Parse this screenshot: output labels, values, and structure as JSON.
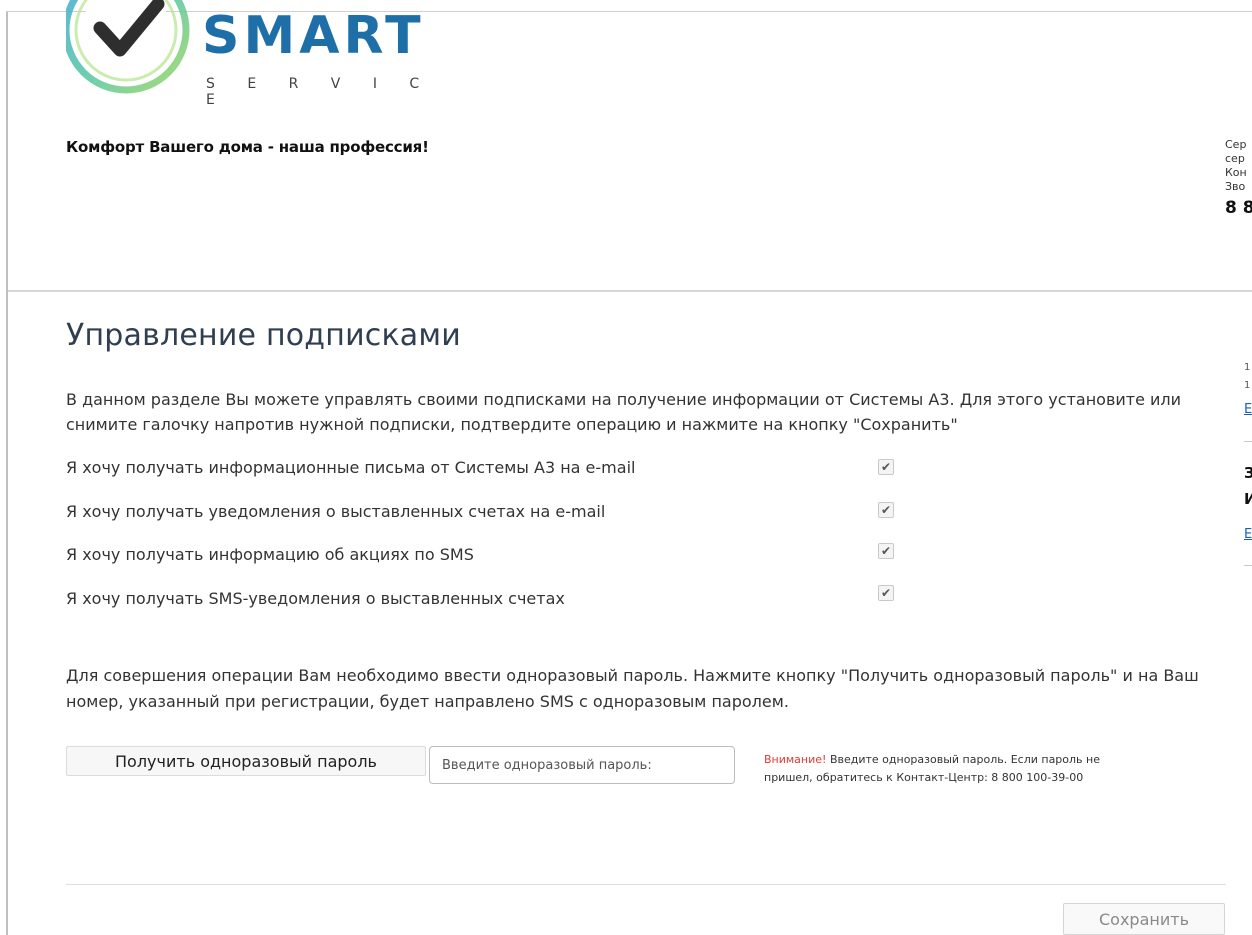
{
  "brand": {
    "name": "SMART",
    "sub": "S E R V I C E",
    "tagline": "Комфорт Вашего дома - наша профессия!"
  },
  "header_right": {
    "lines": [
      "Сер",
      "сер",
      "Кон",
      "Зво"
    ],
    "phone": "8 8"
  },
  "page": {
    "title": "Управление подписками",
    "intro": "В данном разделе Вы можете управлять своими подписками на получение информации от Системы А3. Для этого установите или снимите галочку напротив нужной подписки, подтвердите операцию и нажмите на кнопку \"Сохранить\""
  },
  "subscriptions": [
    {
      "label": "Я хочу получать информационные письма от Системы А3 на e-mail",
      "checked": true
    },
    {
      "label": "Я хочу получать уведомления о выставленных счетах на e-mail",
      "checked": true
    },
    {
      "label": "Я хочу получать информацию об акциях по SMS",
      "checked": true
    },
    {
      "label": "Я хочу получать SMS-уведомления о выставленных счетах",
      "checked": true
    }
  ],
  "otp": {
    "instructions": "Для совершения операции Вам необходимо ввести одноразовый пароль. Нажмите кнопку \"Получить одноразовый пароль\" и на Ваш номер, указанный при регистрации, будет направлено SMS с одноразовым паролем.",
    "button_label": "Получить одноразовый пароль",
    "input_placeholder": "Введите одноразовый пароль:",
    "input_value": "",
    "notice_warning": "Внимание!",
    "notice_text": " Введите одноразовый пароль. Если пароль не пришел, обратитесь к Контакт-Центр: 8 800 100-39-00"
  },
  "actions": {
    "save_label": "Сохранить"
  },
  "sidebar_fragments": {
    "small_1": "1",
    "small_2": "1",
    "link_1": "Е",
    "bold_1": "З",
    "bold_2": "И",
    "link_2": "Е"
  },
  "colors": {
    "title": "#2f3e50",
    "warning": "#e53935",
    "link": "#1a5fb4",
    "logo_blue": "#1e6fa8",
    "logo_green": "#8fd14f"
  }
}
